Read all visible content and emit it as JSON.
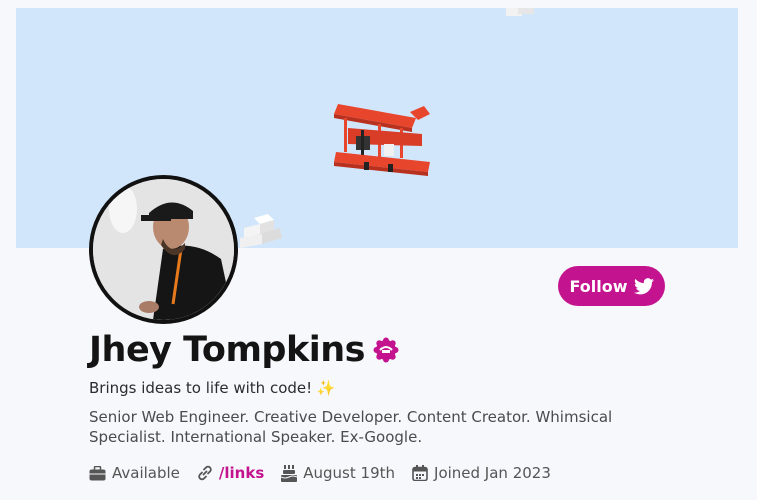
{
  "profile": {
    "name": "Jhey Tompkins",
    "tagline": "Brings ideas to life with code! ✨",
    "bio": "Senior Web Engineer. Creative Developer. Content Creator. Whimsical Specialist. International Speaker. Ex-Google."
  },
  "follow_button": {
    "label": "Follow",
    "icon": "twitter-bird-icon"
  },
  "meta": {
    "availability": "Available",
    "links": "/links",
    "birthday": "August 19th",
    "joined": "Joined Jan 2023"
  },
  "colors": {
    "accent": "#c4138f",
    "banner": "#d2e6fb",
    "background": "#f7f8fb",
    "plane": "#e8452d"
  }
}
